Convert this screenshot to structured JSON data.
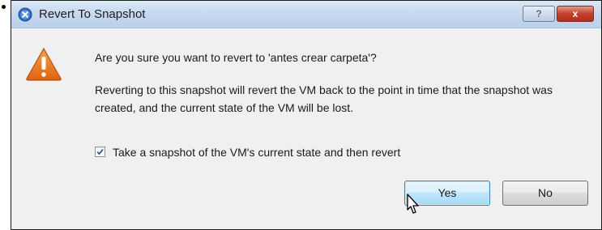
{
  "dialog": {
    "title": "Revert To Snapshot",
    "help_label": "?",
    "close_label": "x"
  },
  "content": {
    "question": "Are you sure you want to revert to 'antes crear carpeta'?",
    "message": "Reverting to this snapshot will revert the VM back to the point in time that the snapshot was created, and the current state of the VM will be lost.",
    "checkbox_label": "Take a snapshot of the VM's current state and then revert",
    "checkbox_checked": true
  },
  "buttons": {
    "yes_label": "Yes",
    "no_label": "No"
  },
  "icons": {
    "title": "vmware-icon",
    "warning": "warning-icon",
    "cursor": "mouse-pointer-icon"
  },
  "colors": {
    "titlebar": "#c4d7ee",
    "warning": "#e8731c",
    "close": "#c0412c"
  }
}
